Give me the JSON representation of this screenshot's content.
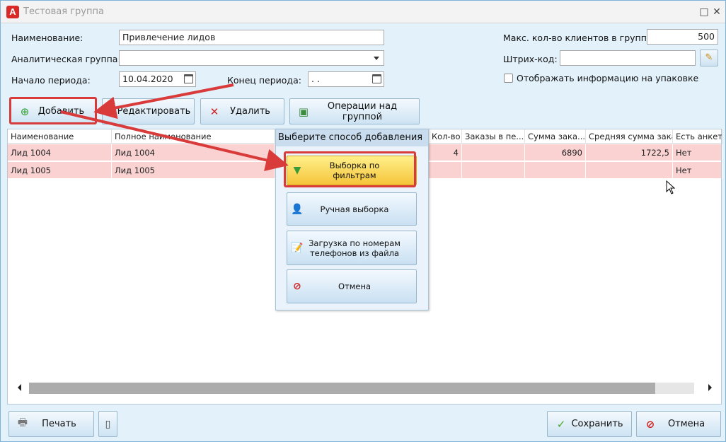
{
  "window": {
    "title": "Тестовая группа",
    "app_icon_letter": "A",
    "maximize_glyph": "□",
    "close_glyph": "✕"
  },
  "form": {
    "name_label": "Наименование:",
    "name_value": "Привлечение лидов",
    "analytic_label": "Аналитическая группа:",
    "analytic_value": "",
    "period_start_label": "Начало периода:",
    "period_start_value": "10.04.2020",
    "period_end_label": "Конец периода:",
    "period_end_value": " .  .",
    "max_clients_label": "Макс. кол-во клиентов в группе:",
    "max_clients_value": "500",
    "barcode_label": "Штрих-код:",
    "barcode_value": "",
    "show_on_pack_label": "Отображать информацию на упаковке",
    "show_on_pack_checked": false
  },
  "toolbar": {
    "add_label": "Добавить",
    "edit_label": "Редактировать",
    "delete_label": "Удалить",
    "ops_label": "Операции над группой"
  },
  "table": {
    "columns": [
      "Наименование",
      "Полное наименование",
      "",
      "Кол-во з...",
      "Заказы в пе...",
      "Сумма зака...",
      "Средняя сумма заказа",
      "Есть анкета"
    ],
    "rows": [
      [
        "Лид 1004",
        "Лид 1004",
        "",
        "4",
        "",
        "6890",
        "1722,5",
        "Нет"
      ],
      [
        "Лид 1005",
        "Лид 1005",
        "",
        "",
        "",
        "",
        "",
        "Нет"
      ]
    ]
  },
  "popup": {
    "title": "Выберите способ добавления",
    "filter_label": "Выборка по фильтрам",
    "manual_label": "Ручная выборка",
    "load_line1": "Загрузка по номерам",
    "load_line2": "телефонов из файла",
    "cancel_label": "Отмена"
  },
  "bottom": {
    "print_label": "Печать",
    "save_label": "Сохранить",
    "cancel_label": "Отмена"
  },
  "colors": {
    "row_highlight": "#fad2d2",
    "annotation_red": "#d93a3a",
    "active_button": "#f5c43a"
  }
}
